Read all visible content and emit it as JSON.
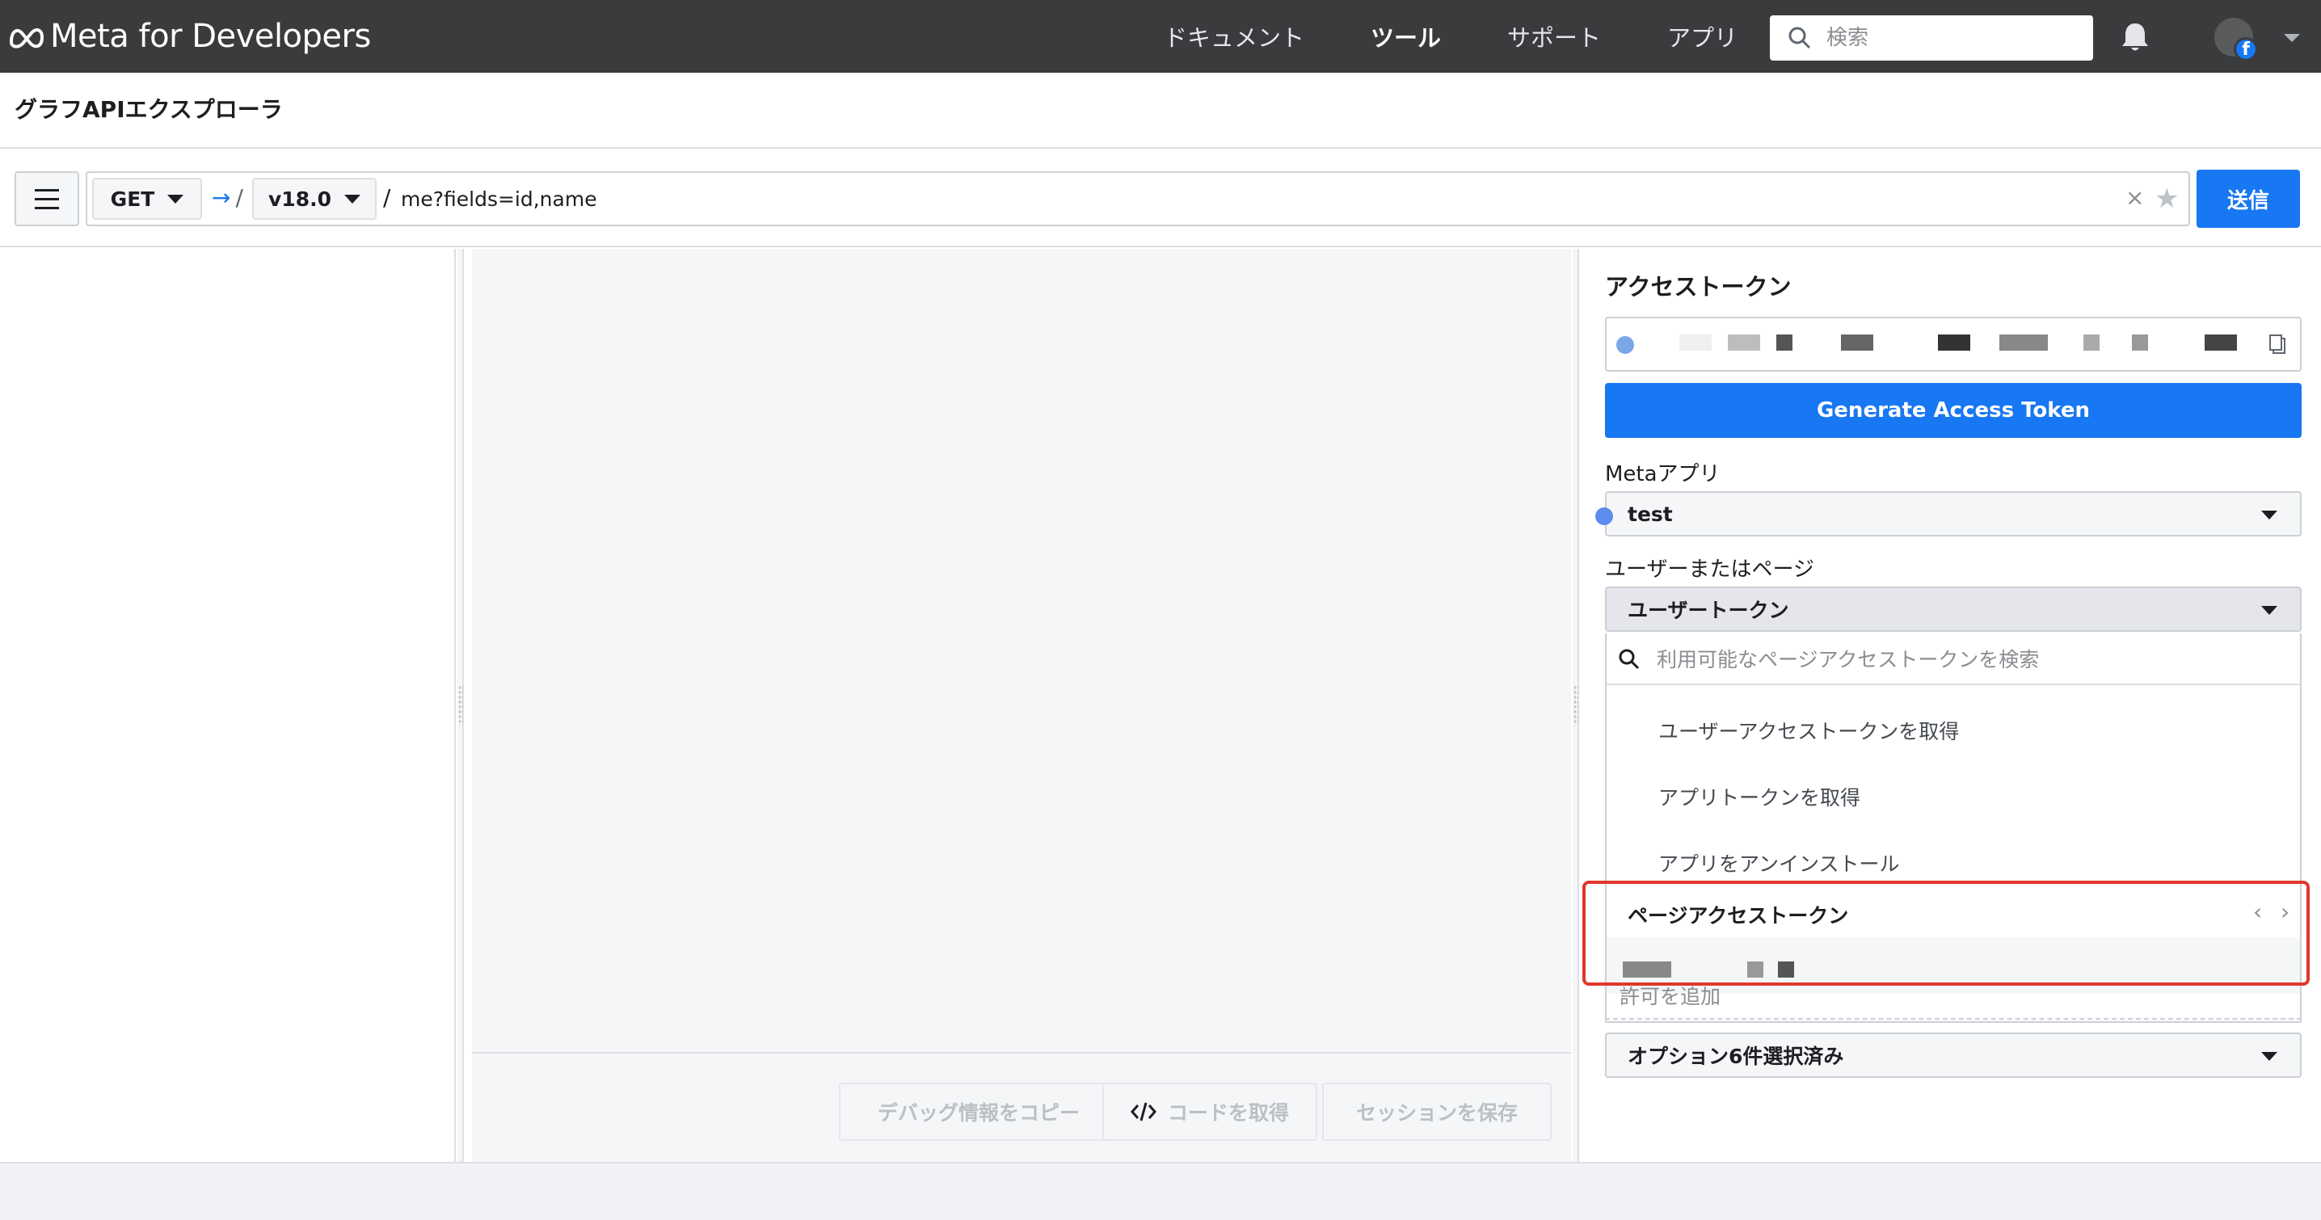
{
  "topnav": {
    "brand": "Meta for Developers",
    "links": [
      "ドキュメント",
      "ツール",
      "サポート",
      "アプリ"
    ],
    "active_link": "ツール",
    "search_placeholder": "検索"
  },
  "page": {
    "title": "グラフAPIエクスプローラ"
  },
  "query": {
    "method": "GET",
    "version": "v18.0",
    "path": "me?fields=id,name",
    "clear_symbol": "×",
    "send_label": "送信"
  },
  "center_footer": {
    "copy_debug_label": "デバッグ情報をコピー",
    "get_code_label": "コードを取得",
    "save_session_label": "セッションを保存"
  },
  "access_panel": {
    "title": "アクセストークン",
    "generate_label": "Generate Access Token",
    "meta_app_label": "Metaアプリ",
    "meta_app_value": "test",
    "user_or_page_label": "ユーザーまたはページ",
    "user_or_page_value": "ユーザートークン",
    "dropdown": {
      "search_placeholder": "利用可能なページアクセストークンを検索",
      "items": [
        "ユーザーアクセストークンを取得",
        "アプリトークンを取得",
        "アプリをアンインストール"
      ],
      "section_title": "ページアクセストークン"
    },
    "add_permission_label": "許可を追加",
    "options_selected": "オプション6件選択済み"
  },
  "colors": {
    "accent": "#1877f2",
    "nav_bg": "#3a3b3c",
    "highlight": "#e0372c"
  }
}
